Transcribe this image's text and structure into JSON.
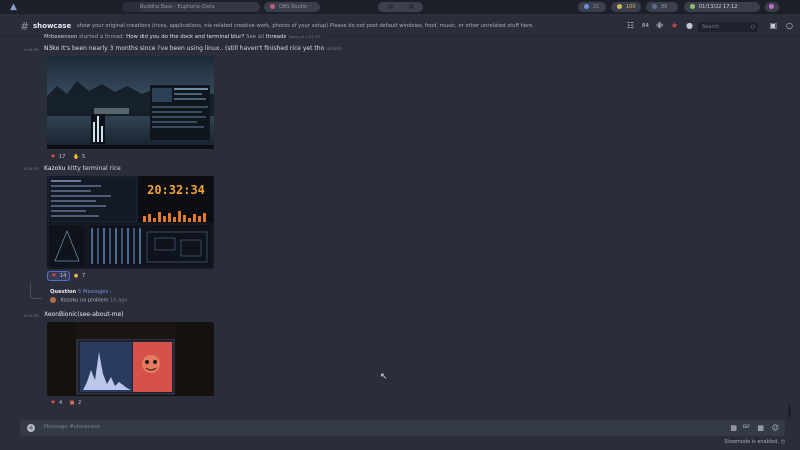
{
  "topbar": {
    "app_icon": "arch-icon",
    "window_title": "Buddha Bass - Euphoria (Dela",
    "obs_label": "OBS Studio",
    "indicator_value": "21",
    "lock_value": "100",
    "network_value": "86",
    "datetime": "01/13/22  17:12"
  },
  "header": {
    "channel_name": "showcase",
    "topic": "show your original creations (rices, applications, nix-related creative work, photos of your setup) Please do not post default windows, food, music, or other unrelated stuff here.",
    "thread_count": "84",
    "search_placeholder": "Search"
  },
  "system_message": {
    "user": "Mrbeeenson",
    "action": "started a thread:",
    "thread_title": "How did you do the dock and terminal blur?",
    "see_all": "See all",
    "threads": "threads",
    "time": "Today at 4:56 PM"
  },
  "messages": [
    {
      "time": "4:56 PM",
      "author": "N3ko",
      "text": "It's been nearly 3 months since i've been using linux.. (still haven't finished rice yet tho",
      "edited": "(edited)",
      "reactions": [
        {
          "emoji": "heart-emoji",
          "count": "17"
        },
        {
          "emoji": "thumbs-up-emoji",
          "count": "5"
        }
      ]
    },
    {
      "time": "4:58 PM",
      "author": "Kazoku",
      "text": "kitty terminal rice",
      "clock_text": "20:32:34",
      "reactions": [
        {
          "emoji": "heart-emoji",
          "count": "14"
        },
        {
          "emoji": "cat-emoji",
          "count": "7"
        }
      ],
      "thread": {
        "title": "Question",
        "messages_link": "5 Messages ›",
        "last_author": "Kazoku",
        "last_text": "no problem",
        "ago": "1h ago"
      }
    },
    {
      "time": "4:59 PM",
      "author": "XeonBionic(see-about-me)",
      "text": "",
      "reactions": [
        {
          "emoji": "heart-emoji",
          "count": "4"
        },
        {
          "emoji": "invader-emoji",
          "count": "2"
        }
      ]
    }
  ],
  "composer": {
    "placeholder": "Message #showcase",
    "slowmode": "Slowmode is enabled."
  },
  "colors": {
    "background": "#2a2e3a",
    "topbar": "#1d2029",
    "accent": "#5a6bc7",
    "heart": "#e0444f"
  }
}
